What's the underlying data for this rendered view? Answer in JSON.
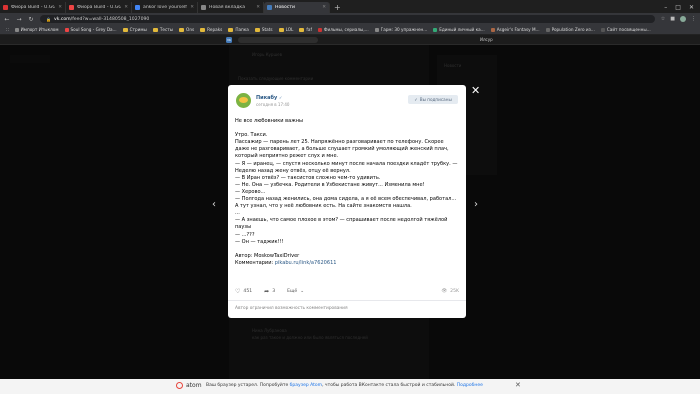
{
  "browser": {
    "tabs": [
      {
        "label": "Фиора Build - U.GG Фиора Ranked",
        "color": "#d33",
        "active": false
      },
      {
        "label": "Фиора Build - U.GG Фиора Ranke...",
        "color": "#e44",
        "active": false
      },
      {
        "label": "ankor love yourself - Поиск в G...",
        "color": "#4285f4",
        "active": false
      },
      {
        "label": "Новая вкладка",
        "color": "#888",
        "active": false
      },
      {
        "label": "Новости",
        "color": "#447bba",
        "active": true
      }
    ],
    "url_domain": "vk.com",
    "url_path": "/feed?w=wall-31480508_1027090",
    "bookmarks": [
      {
        "label": "Импорт Итыклом",
        "type": "site",
        "color": "#888"
      },
      {
        "label": "Soul Song - Grey Da...",
        "type": "site",
        "color": "#e44"
      },
      {
        "label": "Стримы",
        "type": "folder"
      },
      {
        "label": "Тесты",
        "type": "folder"
      },
      {
        "label": "Ons",
        "type": "folder"
      },
      {
        "label": "Repaks",
        "type": "folder"
      },
      {
        "label": "Папка",
        "type": "folder"
      },
      {
        "label": "Stats",
        "type": "folder"
      },
      {
        "label": "LOL",
        "type": "folder"
      },
      {
        "label": "faf",
        "type": "folder"
      },
      {
        "label": "Фильмы, сериалы,...",
        "type": "site",
        "color": "#c33"
      },
      {
        "label": "Гарм: 30 упражнен...",
        "type": "site",
        "color": "#888"
      },
      {
        "label": "Единый личный ка...",
        "type": "site",
        "color": "#3a7"
      },
      {
        "label": "Asgeir's Fantasy M...",
        "type": "site",
        "color": "#a64"
      },
      {
        "label": "Population Zero из...",
        "type": "site",
        "color": "#666"
      },
      {
        "label": "Сайт посвященны...",
        "type": "site",
        "color": "#555"
      }
    ]
  },
  "vk": {
    "user": "Илсур"
  },
  "post": {
    "group_name": "Пикабу",
    "verified_icon": "check-icon",
    "date": "сегодня в 17:40",
    "subscribed_label": "Вы подписаны",
    "lines": [
      "Не все любовники важны",
      "",
      "Утро. Такси.",
      "Пассажир — парень лет 25. Напряжённо разговаривает по телефону. Скорее даже не разговаривает, а больше слушает громкий умоляющий женский плач, который неприятно режет слух и мне.",
      "— Я — иранец, — спустя несколько минут после начала поездки кладёт трубку. — Неделю назад жену отвёз, отцу её вернул.",
      "— В Иран отвёз? — таксистов сложно чем-то удивить.",
      "— Не. Она — узбечка. Родители в Узбекистане живут... Изменила мне!",
      "— Херово...",
      "— Полгода назад женились, она дома сидела, а я её всем обеспечивал, работал... А тут узнал, что у неё любовник есть. На сайте знакомств нашла.",
      "...",
      "— А знаешь, что самое плохое в этом? — спрашивает после недолгой тяжёлой паузы",
      "— ...???",
      "— Он — таджик!!!",
      ""
    ],
    "author_line": "Автор: MoskowTaxiDriver",
    "comments_prefix": "Комментарии: ",
    "comments_link": "pikabu.ru/link/a7620611",
    "likes": "451",
    "reposts": "3",
    "more_label": "Ещё",
    "views": "25K",
    "footnote": "Автор ограничил возможность комментирования"
  },
  "atom_banner": {
    "brand": "atom",
    "text_before": "Ваш браузер устарел. Попробуйте ",
    "link1": "браузер Atom",
    "text_after": ", чтобы работа ВКонтакте стала быстрой и стабильной. ",
    "link2": "Подробнее"
  },
  "background": {
    "news_label": "Новости",
    "comment_author": "Игорь Куршев",
    "filter_label": "Показать следующие комментарии",
    "bottom_author": "Нина Лубранова",
    "bottom_text": "как раз такое и должно или было являться последней"
  }
}
